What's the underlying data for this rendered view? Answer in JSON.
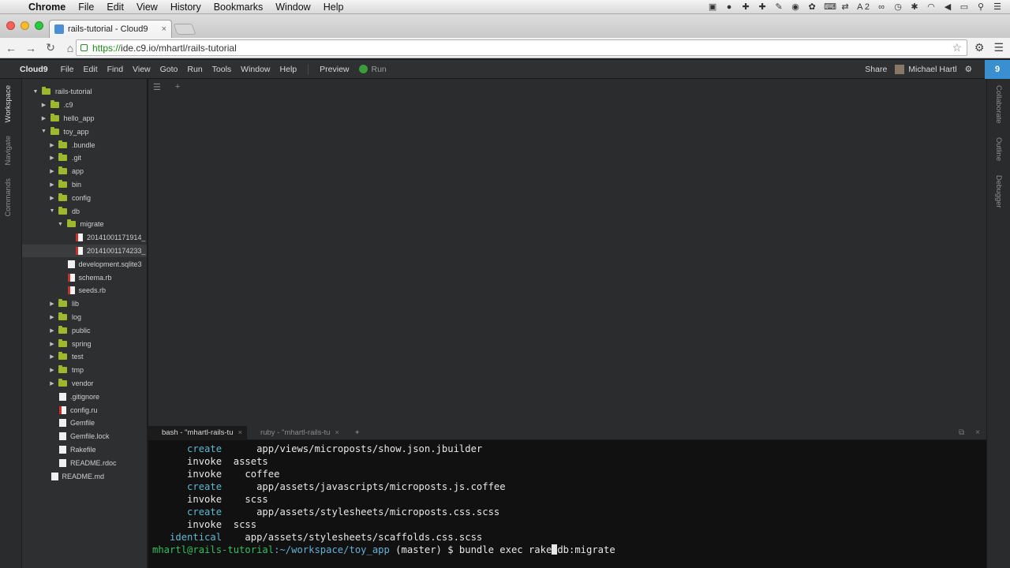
{
  "mac_menubar": {
    "app": "Chrome",
    "items": [
      "File",
      "Edit",
      "View",
      "History",
      "Bookmarks",
      "Window",
      "Help"
    ],
    "status_text": "2"
  },
  "browser": {
    "tab_title": "rails-tutorial - Cloud9",
    "url_scheme": "https://",
    "url_rest": "ide.c9.io/mhartl/rails-tutorial"
  },
  "c9": {
    "brand": "Cloud9",
    "menu": [
      "File",
      "Edit",
      "Find",
      "View",
      "Goto",
      "Run",
      "Tools",
      "Window",
      "Help"
    ],
    "preview": "Preview",
    "run": "Run",
    "share": "Share",
    "user": "Michael Hartl",
    "badge": "9",
    "left_tabs": [
      "Workspace",
      "Navigate",
      "Commands"
    ],
    "right_tabs": [
      "Collaborate",
      "Outline",
      "Debugger"
    ]
  },
  "tree": [
    {
      "label": "rails-tutorial",
      "depth": 0,
      "type": "folder",
      "open": true
    },
    {
      "label": ".c9",
      "depth": 1,
      "type": "folder",
      "open": false
    },
    {
      "label": "hello_app",
      "depth": 1,
      "type": "folder",
      "open": false
    },
    {
      "label": "toy_app",
      "depth": 1,
      "type": "folder",
      "open": true
    },
    {
      "label": ".bundle",
      "depth": 2,
      "type": "folder",
      "open": false
    },
    {
      "label": ".git",
      "depth": 2,
      "type": "folder",
      "open": false
    },
    {
      "label": "app",
      "depth": 2,
      "type": "folder",
      "open": false
    },
    {
      "label": "bin",
      "depth": 2,
      "type": "folder",
      "open": false
    },
    {
      "label": "config",
      "depth": 2,
      "type": "folder",
      "open": false
    },
    {
      "label": "db",
      "depth": 2,
      "type": "folder",
      "open": true
    },
    {
      "label": "migrate",
      "depth": 3,
      "type": "folder",
      "open": true
    },
    {
      "label": "20141001171914_",
      "depth": 4,
      "type": "rb"
    },
    {
      "label": "20141001174233_",
      "depth": 4,
      "type": "rb",
      "selected": true
    },
    {
      "label": "development.sqlite3",
      "depth": 3,
      "type": "file"
    },
    {
      "label": "schema.rb",
      "depth": 3,
      "type": "rb"
    },
    {
      "label": "seeds.rb",
      "depth": 3,
      "type": "rb"
    },
    {
      "label": "lib",
      "depth": 2,
      "type": "folder",
      "open": false
    },
    {
      "label": "log",
      "depth": 2,
      "type": "folder",
      "open": false
    },
    {
      "label": "public",
      "depth": 2,
      "type": "folder",
      "open": false
    },
    {
      "label": "spring",
      "depth": 2,
      "type": "folder",
      "open": false
    },
    {
      "label": "test",
      "depth": 2,
      "type": "folder",
      "open": false
    },
    {
      "label": "tmp",
      "depth": 2,
      "type": "folder",
      "open": false
    },
    {
      "label": "vendor",
      "depth": 2,
      "type": "folder",
      "open": false
    },
    {
      "label": ".gitignore",
      "depth": 2,
      "type": "file"
    },
    {
      "label": "config.ru",
      "depth": 2,
      "type": "rb"
    },
    {
      "label": "Gemfile",
      "depth": 2,
      "type": "file"
    },
    {
      "label": "Gemfile.lock",
      "depth": 2,
      "type": "file"
    },
    {
      "label": "Rakefile",
      "depth": 2,
      "type": "file"
    },
    {
      "label": "README.rdoc",
      "depth": 2,
      "type": "file"
    },
    {
      "label": "README.md",
      "depth": 1,
      "type": "file"
    }
  ],
  "terminal": {
    "tabs": [
      "bash - \"mhartl-rails-tu",
      "ruby - \"mhartl-rails-tu"
    ],
    "lines": [
      {
        "indent": "      ",
        "verb": "create",
        "kind": "create",
        "gap": "      ",
        "text": "app/views/microposts/show.json.jbuilder"
      },
      {
        "indent": "      ",
        "verb": "invoke",
        "kind": "invoke",
        "gap": "  ",
        "text": "assets"
      },
      {
        "indent": "      ",
        "verb": "invoke",
        "kind": "invoke",
        "gap": "    ",
        "text": "coffee"
      },
      {
        "indent": "      ",
        "verb": "create",
        "kind": "create",
        "gap": "      ",
        "text": "app/assets/javascripts/microposts.js.coffee"
      },
      {
        "indent": "      ",
        "verb": "invoke",
        "kind": "invoke",
        "gap": "    ",
        "text": "scss"
      },
      {
        "indent": "      ",
        "verb": "create",
        "kind": "create",
        "gap": "      ",
        "text": "app/assets/stylesheets/microposts.css.scss"
      },
      {
        "indent": "      ",
        "verb": "invoke",
        "kind": "invoke",
        "gap": "  ",
        "text": "scss"
      },
      {
        "indent": "   ",
        "verb": "identical",
        "kind": "create",
        "gap": "    ",
        "text": "app/assets/stylesheets/scaffolds.css.scss"
      }
    ],
    "prompt_user": "mhartl@rails-tutorial",
    "prompt_path": ":~/workspace/toy_app",
    "prompt_branch": " (master) $ ",
    "command_before_cursor": "bundle exec rake",
    "command_after_cursor": "db:migrate"
  }
}
